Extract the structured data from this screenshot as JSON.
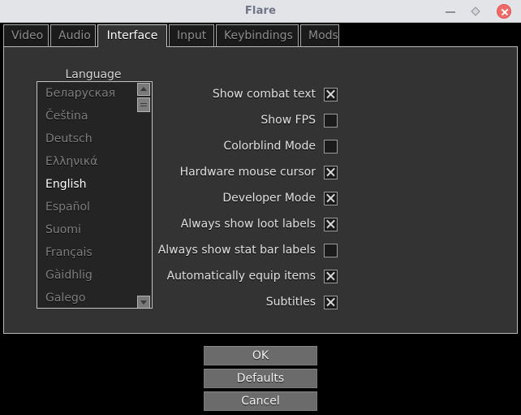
{
  "window": {
    "title": "Flare",
    "controls": [
      {
        "name": "minimize-button",
        "icon": "minimize-icon"
      },
      {
        "name": "maximize-button",
        "icon": "maximize-icon"
      },
      {
        "name": "close-button",
        "icon": "close-icon"
      }
    ]
  },
  "tabs": [
    {
      "label": "Video",
      "active": false
    },
    {
      "label": "Audio",
      "active": false
    },
    {
      "label": "Interface",
      "active": true
    },
    {
      "label": "Input",
      "active": false
    },
    {
      "label": "Keybindings",
      "active": false
    },
    {
      "label": "Mods",
      "active": false
    }
  ],
  "language": {
    "label": "Language",
    "items": [
      {
        "label": "Беларуская",
        "selected": false
      },
      {
        "label": "Čeština",
        "selected": false
      },
      {
        "label": "Deutsch",
        "selected": false
      },
      {
        "label": "Ελληνικά",
        "selected": false
      },
      {
        "label": "English",
        "selected": true
      },
      {
        "label": "Español",
        "selected": false
      },
      {
        "label": "Suomi",
        "selected": false
      },
      {
        "label": "Français",
        "selected": false
      },
      {
        "label": "Gàidhlig",
        "selected": false
      },
      {
        "label": "Galego",
        "selected": false
      }
    ],
    "scrollbar": {
      "up_icon": "chevron-up-icon",
      "down_icon": "chevron-down-icon"
    }
  },
  "options": [
    {
      "label": "Show combat text",
      "checked": true
    },
    {
      "label": "Show FPS",
      "checked": false
    },
    {
      "label": "Colorblind Mode",
      "checked": false
    },
    {
      "label": "Hardware mouse cursor",
      "checked": true
    },
    {
      "label": "Developer Mode",
      "checked": true
    },
    {
      "label": "Always show loot labels",
      "checked": true
    },
    {
      "label": "Always show stat bar labels",
      "checked": false
    },
    {
      "label": "Automatically equip items",
      "checked": true
    },
    {
      "label": "Subtitles",
      "checked": true
    }
  ],
  "buttons": [
    {
      "label": "OK"
    },
    {
      "label": "Defaults"
    },
    {
      "label": "Cancel"
    }
  ],
  "colors": {
    "titlebar": "#e3e4e8",
    "title_text": "#6d7488",
    "panel_bg": "#333333",
    "list_bg": "#242424",
    "close_button": "#f06a6a",
    "button_bg": "#6b6b6b",
    "selected_text": "#ffffff",
    "dim_text": "#7e7e7e"
  }
}
